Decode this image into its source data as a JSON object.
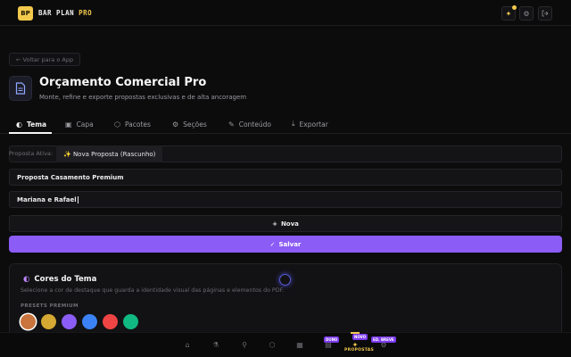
{
  "app": {
    "logo": "BP",
    "brand_main": "BAR PLAN",
    "brand_accent": "PRO",
    "accent_color": "#f2c94c",
    "primary_color": "#8b5cf6"
  },
  "topbar": {
    "icons": [
      "sparkles-icon",
      "gear-icon",
      "logout-icon"
    ]
  },
  "back_button": "← Voltar para o App",
  "header": {
    "title": "Orçamento Comercial Pro",
    "subtitle": "Monte, refine e exporte propostas exclusivas e de alta ancoragem"
  },
  "tabs": [
    {
      "label": "Tema",
      "icon": "palette-icon",
      "active": true
    },
    {
      "label": "Capa",
      "icon": "image-icon",
      "active": false
    },
    {
      "label": "Pacotes",
      "icon": "box-icon",
      "active": false
    },
    {
      "label": "Seções",
      "icon": "gear-icon",
      "active": false
    },
    {
      "label": "Conteúdo",
      "icon": "edit-icon",
      "active": false
    },
    {
      "label": "Exportar",
      "icon": "download-icon",
      "active": false
    }
  ],
  "proposal": {
    "label": "Proposta Ativa:",
    "selected": "✨ Nova Proposta (Rascunho)"
  },
  "fields": {
    "proposal_name": "Proposta Casamento Premium",
    "client_name": "Mariana e Rafael"
  },
  "buttons": {
    "new": "Nova",
    "save": "Salvar"
  },
  "theme_card": {
    "title": "Cores do Tema",
    "description": "Selecione a cor de destaque que guarda a identidade visual das páginas e elementos do PDF.",
    "presets_label": "PRESETS PREMIUM",
    "presets": [
      "#c8743c",
      "#d4a832",
      "#8b5cf6",
      "#3b82f6",
      "#ef4444",
      "#10b981"
    ],
    "selected_index": 0
  },
  "bottom_nav": {
    "items": [
      "home-icon",
      "flask-icon",
      "pin-icon",
      "cube-icon",
      "calendar-icon",
      "clipboard-icon",
      "proposals-icon",
      "settings-icon"
    ],
    "badges": [
      "DUNO",
      "NOVO",
      "ED. BREVE"
    ],
    "active_label": "PROPOSTAS"
  }
}
